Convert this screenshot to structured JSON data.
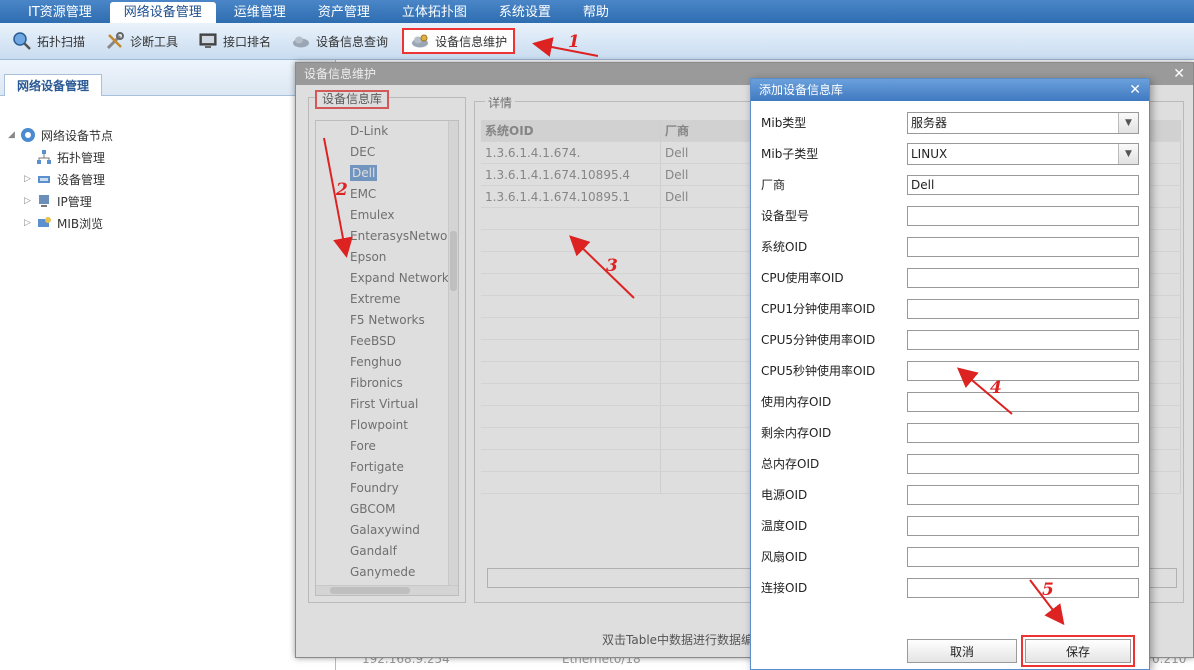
{
  "menu": {
    "tabs": [
      "IT资源管理",
      "网络设备管理",
      "运维管理",
      "资产管理",
      "立体拓扑图",
      "系统设置",
      "帮助"
    ],
    "active_index": 1
  },
  "toolbar": {
    "items": [
      {
        "label": "拓扑扫描",
        "icon": "magnifier-globe-icon"
      },
      {
        "label": "诊断工具",
        "icon": "tools-icon"
      },
      {
        "label": "接口排名",
        "icon": "monitor-icon"
      },
      {
        "label": "设备信息查询",
        "icon": "cloud-search-icon"
      },
      {
        "label": "设备信息维护",
        "icon": "cloud-gear-icon"
      }
    ],
    "highlight_index": 4
  },
  "left_panel": {
    "tab": "网络设备管理",
    "tree": {
      "root": "网络设备节点",
      "children": [
        "拓扑管理",
        "设备管理",
        "IP管理",
        "MIB浏览"
      ]
    }
  },
  "main_modal": {
    "title": "设备信息维护",
    "library_legend": "设备信息库",
    "vendors": [
      "D-Link",
      "DEC",
      "Dell",
      "EMC",
      "Emulex",
      "EnterasysNetworks",
      "Epson",
      "Expand Networks",
      "Extreme",
      "F5 Networks",
      "FeeBSD",
      "Fenghuo",
      "Fibronics",
      "First Virtual",
      "Flowpoint",
      "Fore",
      "Fortigate",
      "Foundry",
      "GBCOM",
      "Galaxywind",
      "Gandalf",
      "Ganymede"
    ],
    "selected_vendor": "Dell",
    "detail_legend": "详情",
    "detail_columns": [
      "系统OID",
      "厂商"
    ],
    "detail_rows": [
      [
        "1.3.6.1.4.1.674.",
        "Dell"
      ],
      [
        "1.3.6.1.4.1.674.10895.4",
        "Dell"
      ],
      [
        "1.3.6.1.4.1.674.10895.1",
        "Dell"
      ]
    ],
    "hint": "双击Table中数据进行数据编",
    "bg_ip": "192.168.9.254",
    "bg_interface": "Ethernet0/18",
    "bg_tail": "0.210"
  },
  "add_dialog": {
    "title": "添加设备信息库",
    "fields": [
      {
        "label": "Mib类型",
        "type": "select",
        "value": "服务器"
      },
      {
        "label": "Mib子类型",
        "type": "select",
        "value": "LINUX"
      },
      {
        "label": "厂商",
        "type": "text",
        "value": "Dell"
      },
      {
        "label": "设备型号",
        "type": "text",
        "value": ""
      },
      {
        "label": "系统OID",
        "type": "text",
        "value": ""
      },
      {
        "label": "CPU使用率OID",
        "type": "text",
        "value": ""
      },
      {
        "label": "CPU1分钟使用率OID",
        "type": "text",
        "value": ""
      },
      {
        "label": "CPU5分钟使用率OID",
        "type": "text",
        "value": ""
      },
      {
        "label": "CPU5秒钟使用率OID",
        "type": "text",
        "value": ""
      },
      {
        "label": "使用内存OID",
        "type": "text",
        "value": ""
      },
      {
        "label": "剩余内存OID",
        "type": "text",
        "value": ""
      },
      {
        "label": "总内存OID",
        "type": "text",
        "value": ""
      },
      {
        "label": "电源OID",
        "type": "text",
        "value": ""
      },
      {
        "label": "温度OID",
        "type": "text",
        "value": ""
      },
      {
        "label": "风扇OID",
        "type": "text",
        "value": ""
      },
      {
        "label": "连接OID",
        "type": "text",
        "value": ""
      }
    ],
    "cancel_label": "取消",
    "save_label": "保存"
  },
  "annotations": [
    "1",
    "2",
    "3",
    "4",
    "5"
  ],
  "colors": {
    "annotation": "#d22222",
    "accent": "#3f79c0"
  }
}
